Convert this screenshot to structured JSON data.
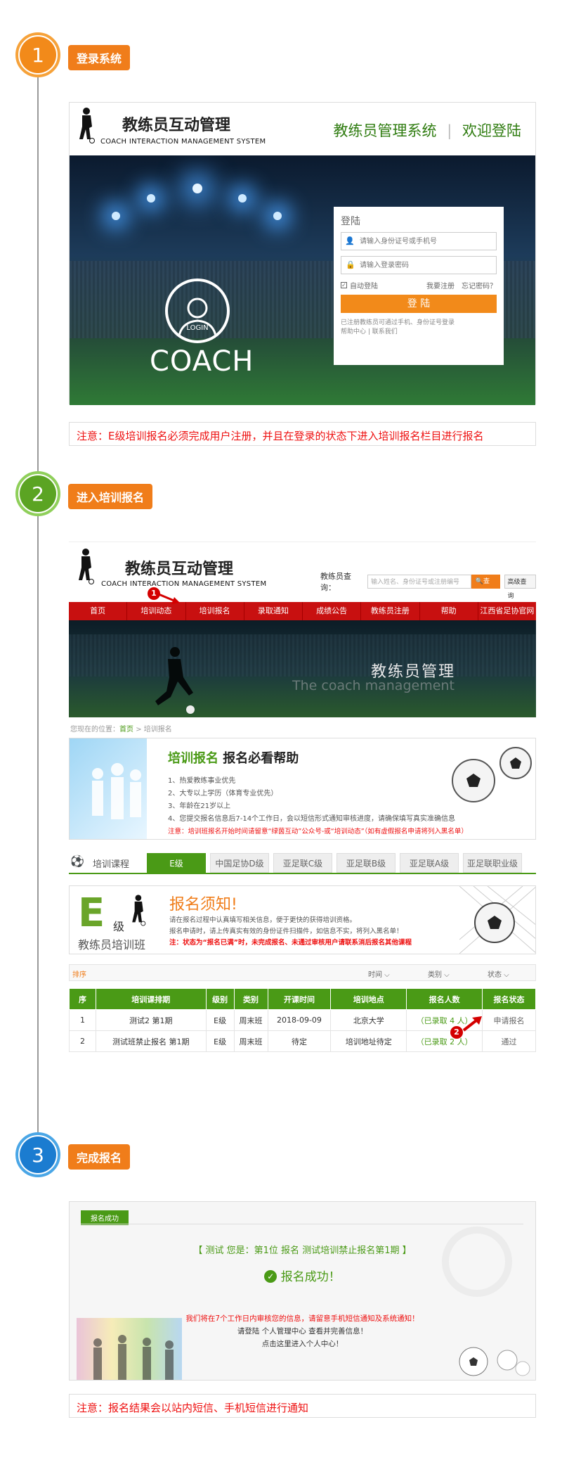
{
  "steps": [
    {
      "num": "1",
      "label": "登录系统"
    },
    {
      "num": "2",
      "label": "进入培训报名"
    },
    {
      "num": "3",
      "label": "完成报名"
    }
  ],
  "login": {
    "site_title": "教练员互动管理",
    "site_sub": "COACH INTERACTION MANAGEMENT SYSTEM",
    "header_right_a": "教练员管理系统",
    "header_right_sep": "|",
    "header_right_b": "欢迎登陆",
    "banner_coach": "COACH",
    "banner_login": "LOGIN",
    "form_title": "登陆",
    "id_placeholder": "请输入身份证号或手机号",
    "pwd_placeholder": "请输入登录密码",
    "auto_login": "自动登陆",
    "register": "我要注册",
    "forgot": "忘记密码？",
    "submit": "登 陆",
    "tip1": "已注册教练员可通过手机、身份证号登录",
    "tip2": "帮助中心 | 联系我们"
  },
  "note1": "注意：E级培训报名必须完成用户注册，并且在登录的状态下进入培训报名栏目进行报名",
  "portal": {
    "site_title": "教练员互动管理",
    "site_sub": "COACH INTERACTION MANAGEMENT SYSTEM",
    "query_label": "教练员查询：",
    "query_placeholder": "输入姓名、身份证号或注册编号",
    "query_btn": "查询",
    "adv_btn": "高级查询",
    "nav": [
      "首页",
      "培训动态",
      "培训报名",
      "录取通知",
      "成绩公告",
      "教练员注册",
      "帮助",
      "江西省足协官网"
    ],
    "banner_cn": "教练员管理",
    "banner_en": "The coach management",
    "breadcrumb_prefix": "您现在的位置：",
    "breadcrumb_home": "首页",
    "breadcrumb_sep": ">",
    "breadcrumb_cur": "培训报名",
    "help_title_a": "培训报名",
    "help_title_b": "报名必看帮助",
    "help_items": [
      "1、热爱教练事业优先",
      "2、大专以上学历（体育专业优先）",
      "3、年龄在21岁以上",
      "4、您提交报名信息后7-14个工作日，会以短信形式通知审核进度，请确保填写真实准确信息"
    ],
    "help_warn": "注意：培训班报名开始时间请留意“绿茵互动”公众号-或“培训动态”（如有虚假报名申请将列入黑名单）",
    "course_label": "培训课程",
    "tabs": [
      "E级",
      "中国足协D级",
      "亚足联C级",
      "亚足联B级",
      "亚足联A级",
      "亚足联职业级"
    ],
    "notice_big_e": "E",
    "notice_level": "级",
    "notice_class": "教练员培训班",
    "notice_title": "报名须知!",
    "notice_l1": "请在报名过程中认真填写相关信息，便于更快的获得培训资格。",
    "notice_l2": "报名申请时，请上传真实有效的身份证件扫描件，如信息不实，将列入黑名单！",
    "notice_l3": "注：状态为“报名已满”时，未完成报名、未通过审核用户请联系消后报名其他课程",
    "sort_label": "排序",
    "filters": [
      "时间 ⌵",
      "类别 ⌵",
      "状态 ⌵"
    ],
    "table_headers": [
      "序",
      "培训课排期",
      "级别",
      "类别",
      "开课时间",
      "培训地点",
      "报名人数",
      "报名状态"
    ],
    "rows": [
      [
        "1",
        "测试2 第1期",
        "E级",
        "周末班",
        "2018-09-09",
        "北京大学",
        "（已录取 4 人）",
        "申请报名"
      ],
      [
        "2",
        "测试班禁止报名 第1期",
        "E级",
        "周末班",
        "待定",
        "培训地址待定",
        "（已录取 2 人）",
        "通过"
      ]
    ],
    "marker1": "1",
    "marker2": "2"
  },
  "success": {
    "tag": "报名成功",
    "line1": "【 测试 您是：第1位 报名 测试培训禁止报名第1期 】",
    "title": "报名成功！",
    "red": "我们将在7个工作日内审核您的信息，请留意手机短信通知及系统通知！",
    "l2": "请登陆 个人管理中心 查看并完善信息！",
    "l3": "点击这里进入个人中心！"
  },
  "note2": "注意：报名结果会以站内短信、手机短信进行通知",
  "colors": {
    "orange": "#f07d1a",
    "green": "#4a9a16",
    "red": "#c81010"
  }
}
